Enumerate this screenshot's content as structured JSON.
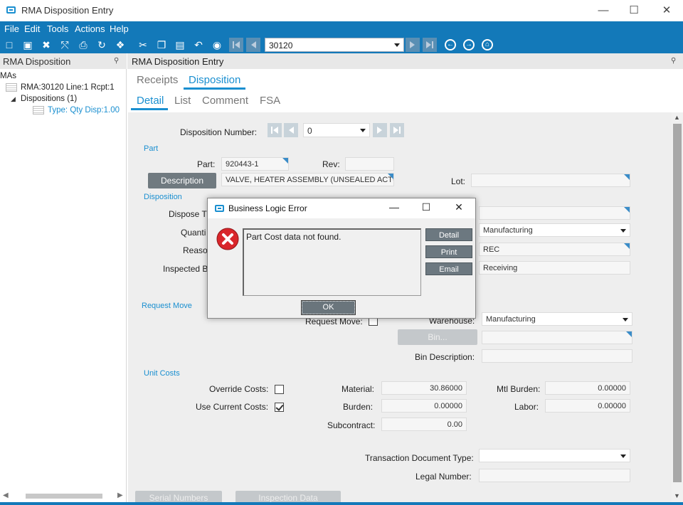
{
  "window": {
    "title": "RMA Disposition Entry"
  },
  "menu": [
    "File",
    "Edit",
    "Tools",
    "Actions",
    "Help"
  ],
  "toolbar": {
    "record_value": "30120"
  },
  "left_panel": {
    "title": "RMA Disposition",
    "tree": {
      "root": "MAs",
      "rma": "RMA:30120 Line:1 Rcpt:1",
      "dispositions": "Dispositions (1)",
      "type_item": "Type: Qty Disp:1.00"
    }
  },
  "main": {
    "title": "RMA Disposition Entry",
    "tabs_top": [
      "Receipts",
      "Disposition"
    ],
    "tabs_sub": [
      "Detail",
      "List",
      "Comment",
      "FSA"
    ]
  },
  "form": {
    "disposition_number_label": "Disposition Number:",
    "disposition_number": "0",
    "section_part": "Part",
    "part_label": "Part:",
    "part_value": "920443-1",
    "rev_label": "Rev:",
    "rev_value": "",
    "description_button": "Description",
    "description_value": "VALVE,  HEATER  ASSEMBLY  (UNSEALED ACTUA",
    "lot_label": "Lot:",
    "lot_value": "",
    "section_disposition": "Disposition",
    "dispose_type_label": "Dispose T",
    "quantity_label": "Quanti",
    "reason_label": "Reaso",
    "inspected_by_label": "Inspected B",
    "dispose_type_value": "",
    "warehouse1_value": "Manufacturing",
    "reason_value": "REC",
    "inspected_value": "Receiving",
    "section_request_move": "Request Move",
    "request_move_label": "Request Move:",
    "warehouse_label": "Warehouse:",
    "warehouse_value": "Manufacturing",
    "bin_button": "Bin...",
    "bin_value": "",
    "bin_description_label": "Bin Description:",
    "bin_description_value": "",
    "section_unit_costs": "Unit Costs",
    "override_costs_label": "Override Costs:",
    "use_current_costs_label": "Use Current Costs:",
    "material_label": "Material:",
    "material_value": "30.86000",
    "burden_label": "Burden:",
    "burden_value": "0.00000",
    "subcontract_label": "Subcontract:",
    "subcontract_value": "0.00",
    "mtl_burden_label": "Mtl Burden:",
    "mtl_burden_value": "0.00000",
    "labor_label": "Labor:",
    "labor_value": "0.00000",
    "transaction_doc_type_label": "Transaction Document Type:",
    "transaction_doc_type_value": "",
    "legal_number_label": "Legal Number:",
    "legal_number_value": "",
    "serial_numbers_button": "Serial Numbers",
    "inspection_data_button": "Inspection Data"
  },
  "dialog": {
    "title": "Business Logic Error",
    "message": "Part Cost data not found.",
    "detail_button": "Detail",
    "print_button": "Print",
    "email_button": "Email",
    "ok_button": "OK"
  },
  "colors": {
    "accent": "#1379b9",
    "link": "#1a8fd0",
    "error": "#d9262b"
  }
}
